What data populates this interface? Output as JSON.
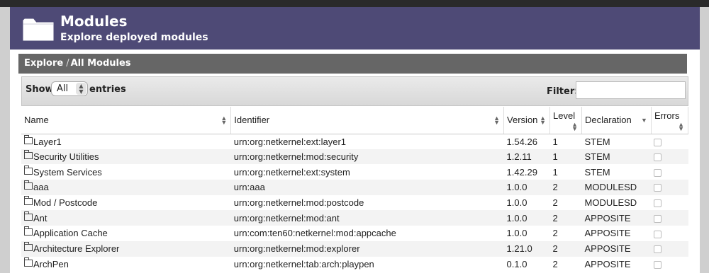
{
  "header": {
    "icon": "folder-icon",
    "title": "Modules",
    "subtitle": "Explore deployed modules"
  },
  "breadcrumb": {
    "root": "Explore",
    "separator": "/",
    "current": "All Modules"
  },
  "controls": {
    "show_label": "Show",
    "show_value": "All",
    "entries_label": "entries",
    "filter_label": "Filter:",
    "filter_value": ""
  },
  "table": {
    "columns": [
      "Name",
      "Identifier",
      "Version",
      "Level",
      "Declaration",
      "Errors"
    ],
    "rows": [
      {
        "name": "Layer1",
        "identifier": "urn:org:netkernel:ext:layer1",
        "version": "1.54.26",
        "level": "1",
        "declaration": "STEM",
        "errors": false
      },
      {
        "name": "Security Utilities",
        "identifier": "urn:org:netkernel:mod:security",
        "version": "1.2.11",
        "level": "1",
        "declaration": "STEM",
        "errors": false
      },
      {
        "name": "System Services",
        "identifier": "urn:org:netkernel:ext:system",
        "version": "1.42.29",
        "level": "1",
        "declaration": "STEM",
        "errors": false
      },
      {
        "name": "aaa",
        "identifier": "urn:aaa",
        "version": "1.0.0",
        "level": "2",
        "declaration": "MODULESD",
        "errors": false
      },
      {
        "name": "Mod / Postcode",
        "identifier": "urn:org:netkernel:mod:postcode",
        "version": "1.0.0",
        "level": "2",
        "declaration": "MODULESD",
        "errors": false
      },
      {
        "name": "Ant",
        "identifier": "urn:org:netkernel:mod:ant",
        "version": "1.0.0",
        "level": "2",
        "declaration": "APPOSITE",
        "errors": false
      },
      {
        "name": "Application Cache",
        "identifier": "urn:com:ten60:netkernel:mod:appcache",
        "version": "1.0.0",
        "level": "2",
        "declaration": "APPOSITE",
        "errors": false
      },
      {
        "name": "Architecture Explorer",
        "identifier": "urn:org:netkernel:mod:explorer",
        "version": "1.21.0",
        "level": "2",
        "declaration": "APPOSITE",
        "errors": false
      },
      {
        "name": "ArchPen",
        "identifier": "urn:org:netkernel:tab:arch:playpen",
        "version": "0.1.0",
        "level": "2",
        "declaration": "APPOSITE",
        "errors": false
      }
    ]
  },
  "colors": {
    "header_bg": "#4e4a76",
    "breadcrumb_bg": "#666666",
    "topbar_bg": "#2a2a2a"
  }
}
